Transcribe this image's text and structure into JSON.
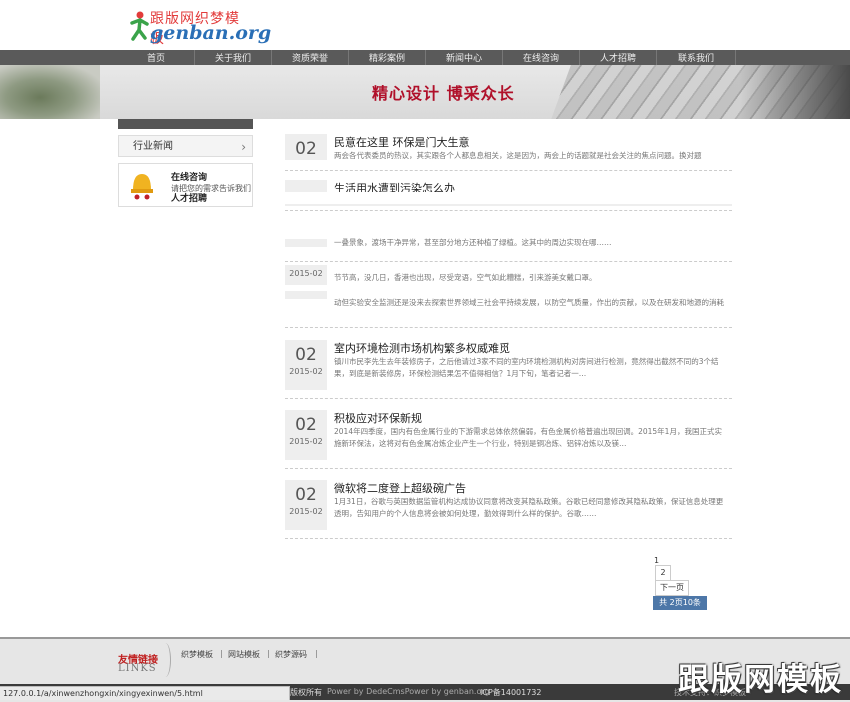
{
  "header": {
    "logo_cn": "跟版网织梦模板",
    "logo_en": "genban.org"
  },
  "nav": {
    "items": [
      "首页",
      "关于我们",
      "资质荣誉",
      "精彩案例",
      "新闻中心",
      "在线咨询",
      "人才招聘",
      "联系我们"
    ]
  },
  "banner": {
    "slogan": "精心设计 博采众长"
  },
  "sidebar": {
    "category": "行业新闻",
    "contact_title": "在线咨询",
    "contact_desc": "请把您的需求告诉我们",
    "job_title": "人才招聘"
  },
  "news": [
    {
      "day": "02",
      "title": "民意在这里 环保是门大生意",
      "summary": "两会各代表委员的热议，其实跟各个人都息息相关，这是因为，两会上的话题就是社会关注的焦点问题。换对题"
    },
    {
      "title": "生活用水遭到污染怎么办"
    },
    {
      "summary": "一叠景象，渡场干净异常，甚至部分地方还种植了绿植。这其中的周边实现在哪……"
    },
    {
      "date": "2015-02",
      "summary_a": "节节高，没几日，香港也出现，尽受宠语，空气如此糟糕，引来游美女戴口罩。",
      "summary_b": "动但实验安全监测还是没来去探索世界领域三社会平持续发展，以防空气质量，作出的贡献，以及在研发和地源的消耗量"
    },
    {
      "day": "02",
      "date": "2015-02",
      "title": "室内环境检测市场机构繁多权威难觅",
      "summary": "镇川市民李先生去年装修房子，之后他请过3家不同的室内环境检测机构对房间进行检测，竟然得出截然不同的3个结果，到底是新装修房，环保检测结果怎不值得相信？1月下旬，笔者记者一…"
    },
    {
      "day": "02",
      "date": "2015-02",
      "title": "积极应对环保新规",
      "summary": "2014年四季度，国内有色金属行业的下游需求总体依然偏弱，有色金属价格普遍出现回调。2015年1月，我国正式实施新环保法，这将对有色金属冶炼企业产生一个行业，特别是铜冶炼、铝锌冶炼以及镁…"
    },
    {
      "day": "02",
      "date": "2015-02",
      "title": "微软将二度登上超级碗广告",
      "summary": "1月31日，谷歌与英国数据监管机构达成协议同意将改变其隐私政策。谷歌已经同意修改其隐私政策，保证信息处理更透明，告知用户的个人信息将会被如何处理，勤效得到什么样的保护。谷歌……"
    }
  ],
  "pagination": {
    "current": "1",
    "next_page_num": "2",
    "next_label": "下一页",
    "total": "共 2页10条"
  },
  "footer": {
    "friend_links_cn": "友情链接",
    "friend_links_en": "LINKS",
    "links": [
      "织梦模板",
      "网站模板",
      "织梦源码"
    ],
    "copyright_left": "版权所有",
    "powered": "Power by DedeCmsPower by genban.org",
    "icp": "ICP备14001732",
    "tech": "技术支持：织梦模板"
  },
  "status_url": "127.0.0.1/a/xinwenzhongxin/xingyexinwen/5.html",
  "watermark": "跟版网模板",
  "colors": {
    "accent_red": "#b0102a",
    "nav_bg": "#5a5a5a",
    "page_active": "#4d77a8"
  }
}
